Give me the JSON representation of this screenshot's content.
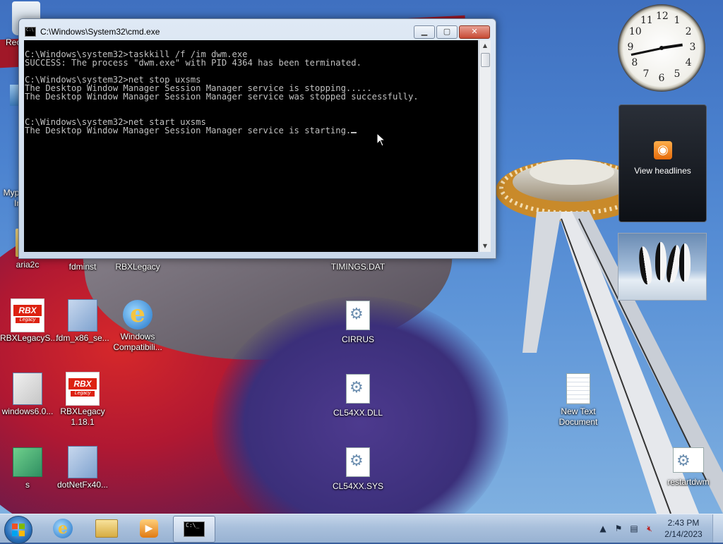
{
  "desktop": {
    "icons": [
      {
        "id": "recycle",
        "label": "Rec"
      },
      {
        "id": "aria2c",
        "label": "aria2c"
      },
      {
        "id": "fdminst",
        "label": "fdminst"
      },
      {
        "id": "rbxlegacy",
        "label": "RBXLegacy"
      },
      {
        "id": "timings",
        "label": "TIMINGS.DAT"
      },
      {
        "id": "rbxlegacys",
        "label": "RBXLegacyS..."
      },
      {
        "id": "fdm_x86",
        "label": "fdm_x86_se..."
      },
      {
        "id": "wincompat",
        "label": "Windows Compatibili..."
      },
      {
        "id": "cirrus",
        "label": "CIRRUS"
      },
      {
        "id": "windows6",
        "label": "windows6.0..."
      },
      {
        "id": "rbxlegacy118",
        "label": "RBXLegacy 1.18.1"
      },
      {
        "id": "cl54dll",
        "label": "CL54XX.DLL"
      },
      {
        "id": "newtext",
        "label": "New Text Document"
      },
      {
        "id": "s",
        "label": "s"
      },
      {
        "id": "dotnet",
        "label": "dotNetFx40..."
      },
      {
        "id": "cl54sys",
        "label": "CL54XX.SYS"
      },
      {
        "id": "restartdwm",
        "label": "restartdwm"
      },
      {
        "id": "partial_m",
        "label": "M"
      },
      {
        "id": "partial_myp",
        "label": "Myp"
      },
      {
        "id": "partial_in",
        "label": "In"
      }
    ]
  },
  "cmd_window": {
    "title": "C:\\Windows\\System32\\cmd.exe",
    "minimize": "▁",
    "maximize": "▢",
    "close": "✕",
    "lines": [
      "",
      "C:\\Windows\\system32>taskkill /f /im dwm.exe",
      "SUCCESS: The process \"dwm.exe\" with PID 4364 has been terminated.",
      "",
      "C:\\Windows\\system32>net stop uxsms",
      "The Desktop Window Manager Session Manager service is stopping.....",
      "The Desktop Window Manager Session Manager service was stopped successfully.",
      "",
      "",
      "C:\\Windows\\system32>net start uxsms",
      "The Desktop Window Manager Session Manager service is starting."
    ]
  },
  "gadgets": {
    "clock": {
      "hour": 2,
      "minute": 43,
      "numbers": [
        "12",
        "1",
        "2",
        "3",
        "4",
        "5",
        "6",
        "7",
        "8",
        "9",
        "10",
        "11"
      ]
    },
    "feed": {
      "label": "View headlines",
      "icon": "rss-icon"
    },
    "slideshow": {
      "subject": "penguins"
    }
  },
  "taskbar": {
    "pinned": [
      {
        "name": "internet-explorer",
        "icon": "ie-icon"
      },
      {
        "name": "windows-explorer",
        "icon": "folder-icon"
      },
      {
        "name": "media-player",
        "icon": "media-player-icon"
      },
      {
        "name": "cmd",
        "icon": "cmd-icon",
        "active": true
      }
    ],
    "tray": {
      "time": "2:43 PM",
      "date": "2/14/2023",
      "icons": [
        "show-hidden-icons",
        "action-center-icon",
        "network-icon",
        "volume-muted-icon"
      ]
    }
  },
  "colors": {
    "console_bg": "#000000",
    "console_fg": "#c0c0c0",
    "close_button": "#c74a34",
    "taskbar": "#a9c0dc"
  }
}
